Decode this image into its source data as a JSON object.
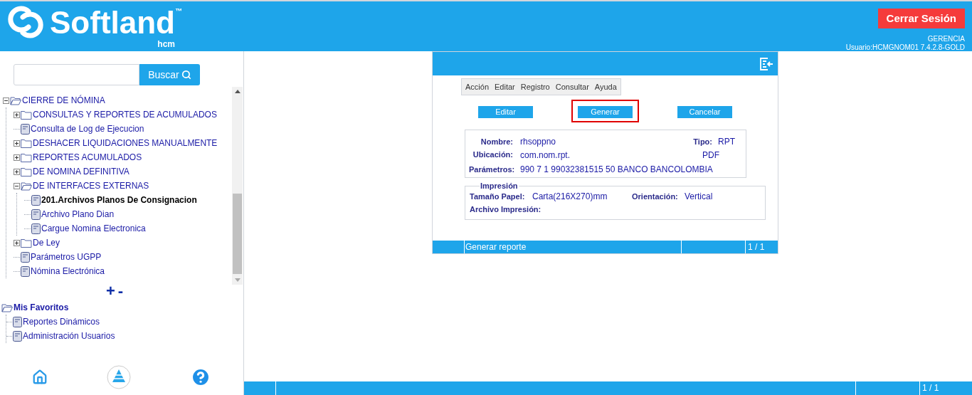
{
  "header": {
    "logo_text": "Softland",
    "trademark": "™",
    "logo_subtext": "hcm",
    "logout_button": "Cerrar Sesión",
    "role": "GERENCIA",
    "user": "Usuario:HCMGNOM01 7.4.2.8-GOLD"
  },
  "sidebar": {
    "search": {
      "button": "Buscar"
    },
    "tree": [
      {
        "label": "CIERRE DE NÓMINA",
        "kind": "folder",
        "expanded": true,
        "selected": false,
        "children": [
          {
            "label": "CONSULTAS Y REPORTES DE ACUMULADOS",
            "kind": "folder",
            "expanded": false,
            "selected": false
          },
          {
            "label": "Consulta de Log de Ejecucion",
            "kind": "doc",
            "selected": false
          },
          {
            "label": "DESHACER LIQUIDACIONES MANUALMENTE",
            "kind": "folder",
            "expanded": false,
            "selected": false
          },
          {
            "label": "REPORTES ACUMULADOS",
            "kind": "folder",
            "expanded": false,
            "selected": false
          },
          {
            "label": "DE NOMINA DEFINITIVA",
            "kind": "folder",
            "expanded": false,
            "selected": false
          },
          {
            "label": "DE INTERFACES EXTERNAS",
            "kind": "folder",
            "expanded": true,
            "selected": false,
            "children": [
              {
                "label": "201.Archivos Planos De Consignacion",
                "kind": "doc",
                "selected": true
              },
              {
                "label": "Archivo Plano Dian",
                "kind": "doc",
                "selected": false
              },
              {
                "label": "Cargue Nomina Electronica",
                "kind": "doc",
                "selected": false
              }
            ]
          },
          {
            "label": "De Ley",
            "kind": "folder",
            "expanded": false,
            "selected": false
          },
          {
            "label": "Parámetros UGPP",
            "kind": "doc",
            "selected": false
          },
          {
            "label": "Nómina Electrónica",
            "kind": "doc",
            "selected": false
          }
        ]
      }
    ],
    "zoom_controls": [
      "+",
      "-"
    ],
    "favorites": {
      "label": "Mis Favoritos",
      "children": [
        {
          "label": "Reportes Dinámicos"
        },
        {
          "label": "Administración Usuarios"
        }
      ]
    }
  },
  "dialog": {
    "menu": [
      "Acción",
      "Editar",
      "Registro",
      "Consultar",
      "Ayuda"
    ],
    "buttons": [
      {
        "label": "Editar",
        "highlighted": false
      },
      {
        "label": "Generar",
        "highlighted": true
      },
      {
        "label": "Cancelar",
        "highlighted": false
      }
    ],
    "report": {
      "nombre_label": "Nombre:",
      "nombre": "rhsoppno",
      "tipo_label": "Tipo:",
      "tipo": "RPT",
      "ubicacion_label": "Ubicación:",
      "ubicacion": "com.nom.rpt.",
      "formato": "PDF",
      "parametros_label": "Parámetros:",
      "parametros": "990 7 1 99032381515 50 BANCO BANCOLOMBIA"
    },
    "impresion": {
      "legend": "Impresión",
      "tamano_label": "Tamaño Papel:",
      "tamano": "Carta(216X270)mm",
      "orientacion_label": "Orientación:",
      "orientacion": "Vertical",
      "archivo_label": "Archivo Impresión:"
    },
    "status_bar": {
      "message": "Generar reporte",
      "page": "1 / 1"
    }
  },
  "status_bar": {
    "page": "1 / 1"
  }
}
